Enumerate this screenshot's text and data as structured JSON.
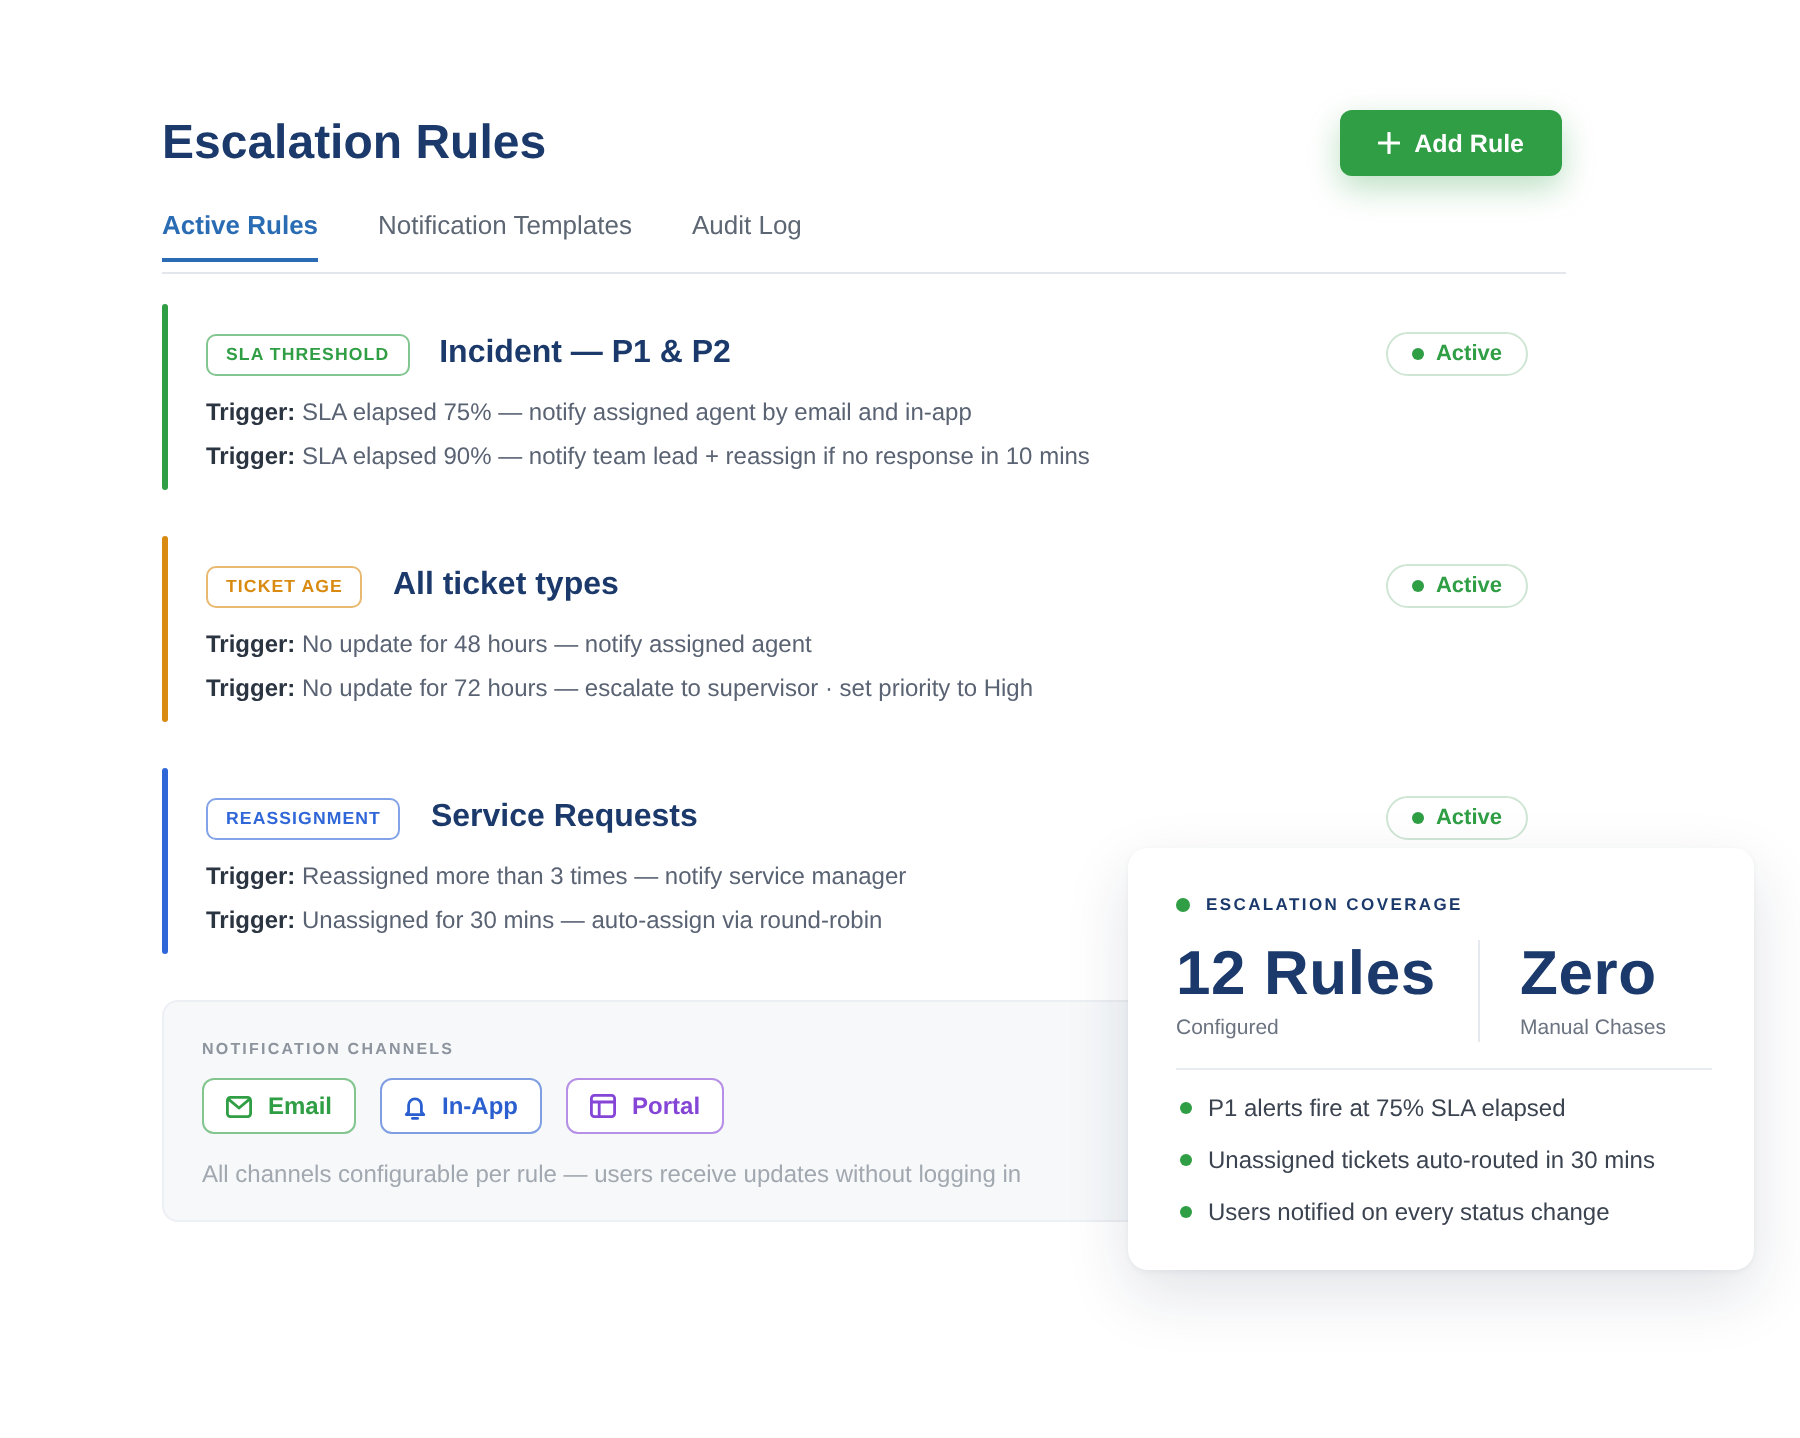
{
  "header": {
    "title": "Escalation Rules",
    "add_button": "Add Rule"
  },
  "tabs": [
    {
      "label": "Active Rules",
      "selected": true
    },
    {
      "label": "Notification Templates",
      "selected": false
    },
    {
      "label": "Audit Log",
      "selected": false
    }
  ],
  "rules": [
    {
      "tag": "SLA THRESHOLD",
      "color": "#2f9e44",
      "title": "Incident — P1 & P2",
      "status": "Active",
      "triggers": [
        "**Trigger:** SLA elapsed 75% — notify assigned agent by email and in-app",
        "**Trigger:** SLA elapsed 90% — notify team lead + reassign if no response in 10 mins"
      ]
    },
    {
      "tag": "TICKET AGE",
      "color": "#d98a10",
      "title": "All ticket types",
      "status": "Active",
      "triggers": [
        "**Trigger:** No update for 48 hours — notify assigned agent",
        "**Trigger:** No update for 72 hours — escalate to supervisor · set priority to High"
      ]
    },
    {
      "tag": "REASSIGNMENT",
      "color": "#2f66d8",
      "title": "Service Requests",
      "status": "Active",
      "triggers": [
        "**Trigger:** Reassigned more than 3 times — notify service manager",
        "**Trigger:** Unassigned for 30 mins — auto-assign via round-robin"
      ]
    }
  ],
  "notification_channels": {
    "label": "NOTIFICATION CHANNELS",
    "channels": [
      {
        "kind": "email",
        "label": "Email",
        "color": "#2f9e44"
      },
      {
        "kind": "in_app",
        "label": "In-App",
        "color": "#2b5fcf"
      },
      {
        "kind": "portal",
        "label": "Portal",
        "color": "#8545d6"
      }
    ],
    "note": "All channels configurable per rule — users receive updates without logging in"
  },
  "coverage_card": {
    "heading": "ESCALATION COVERAGE",
    "stats": [
      {
        "value": "12 Rules",
        "label": "Configured"
      },
      {
        "value": "Zero",
        "label": "Manual Chases"
      }
    ],
    "highlights": [
      "P1 alerts fire at 75% SLA elapsed",
      "Unassigned tickets auto-routed in 30 mins",
      "Users notified on every status change"
    ]
  }
}
